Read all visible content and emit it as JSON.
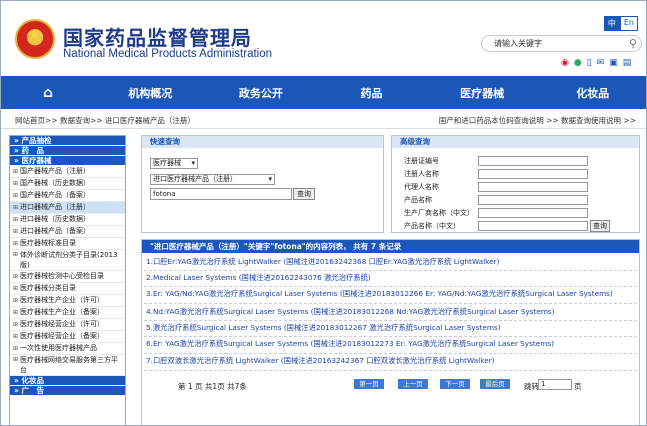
{
  "header": {
    "title_cn": "国家药品监督管理局",
    "title_en": "National Medical Products Administration",
    "lang_cn": "中",
    "lang_en": "En",
    "search_placeholder": "请输入关键字",
    "social_icons": [
      "weibo-icon",
      "wechat-icon",
      "mobile-icon",
      "email-icon",
      "message-icon",
      "book-icon"
    ],
    "brand_color": "#1b57b8"
  },
  "nav": {
    "items": [
      "机构概况",
      "政务公开",
      "药品",
      "医疗器械",
      "化妆品"
    ]
  },
  "breadcrumb": {
    "left": "网站首页>> 数据查询>> 进口医疗器械产品（注册）",
    "right": "国产和进口药品本位码查询说明 >>    数据查询使用说明 >>"
  },
  "sidebar": {
    "items": [
      {
        "label": "» 产品抽检",
        "type": "head"
      },
      {
        "label": "» 药　品",
        "type": "head"
      },
      {
        "label": "» 医疗器械",
        "type": "head"
      },
      {
        "label": "国产器械产品（注册）",
        "type": "item"
      },
      {
        "label": "国产器械（历史数据）",
        "type": "item"
      },
      {
        "label": "国产器械产品（备案）",
        "type": "item"
      },
      {
        "label": "进口器械产品（注册）",
        "type": "active"
      },
      {
        "label": "进口器械（历史数据）",
        "type": "item"
      },
      {
        "label": "进口器械产品（备案）",
        "type": "item"
      },
      {
        "label": "医疗器械标准目录",
        "type": "item"
      },
      {
        "label": "体外诊断试剂分类子目录(2013版)",
        "type": "item"
      },
      {
        "label": "医疗器械检测中心受检目录",
        "type": "item"
      },
      {
        "label": "医疗器械分类目录",
        "type": "item"
      },
      {
        "label": "医疗器械生产企业（许可）",
        "type": "item"
      },
      {
        "label": "医疗器械生产企业（备案）",
        "type": "item"
      },
      {
        "label": "医疗器械经营企业（许可）",
        "type": "item"
      },
      {
        "label": "医疗器械经营企业（备案）",
        "type": "item"
      },
      {
        "label": "一次性使用医疗器械产品",
        "type": "item"
      },
      {
        "label": "医疗器械网络交易服务第三方平台",
        "type": "item"
      },
      {
        "label": "» 化妆品",
        "type": "head"
      },
      {
        "label": "» 广　告",
        "type": "head"
      }
    ]
  },
  "quick": {
    "title": "快速查询",
    "select1": "医疗器械",
    "select2": "进口医疗器械产品（注册）",
    "query": "fotona",
    "btn": "查询"
  },
  "advanced": {
    "title": "高级查询",
    "fields": [
      "注册证编号",
      "注册人名称",
      "代理人名称",
      "产品名称",
      "生产厂商名称（中文）",
      "产品名称（中文）"
    ],
    "btn": "查询"
  },
  "results": {
    "header": "\"进口医疗器械产品（注册）\"关键字\"fotona\"的内容列表， 共有 7 条记录",
    "items": [
      "1.口腔Er:YAG激光治疗系统 LightWalker (国械注进20163242368 口腔Er:YAG激光治疗系统 LightWalker)",
      "2.Medical Laser Systems (国械注进20162243076 激光治疗系统)",
      "3.Er:  YAG/Nd:YAG激光治疗系统Surgical Laser Systems (国械注进20183012266 Er:  YAG/Nd:YAG激光治疗系统Surgical Laser Systems)",
      "4.Nd:YAG激光治疗系统Surgical Laser Systems (国械注进20183012268 Nd:YAG激光治疗系统Surgical Laser Systems)",
      "5.激光治疗系统Surgical Laser Systems (国械注进20183012267 激光治疗系统Surgical Laser Systems)",
      "6.Er:  YAG激光治疗系统Surgical Laser Systems (国械注进20183012273 Er:  YAG激光治疗系统Surgical Laser Systems)",
      "7.口腔双波长激光治疗系统 LightWalker (国械注进20163242367 口腔双波长激光治疗系统 LightWalker)"
    ],
    "pager": {
      "info": "第 1 页 共1页 共7条",
      "first": "第一页",
      "prev": "上一页",
      "next": "下一页",
      "last": "最后页",
      "jump": "跳转",
      "page": "1",
      "page_unit": "页"
    }
  }
}
